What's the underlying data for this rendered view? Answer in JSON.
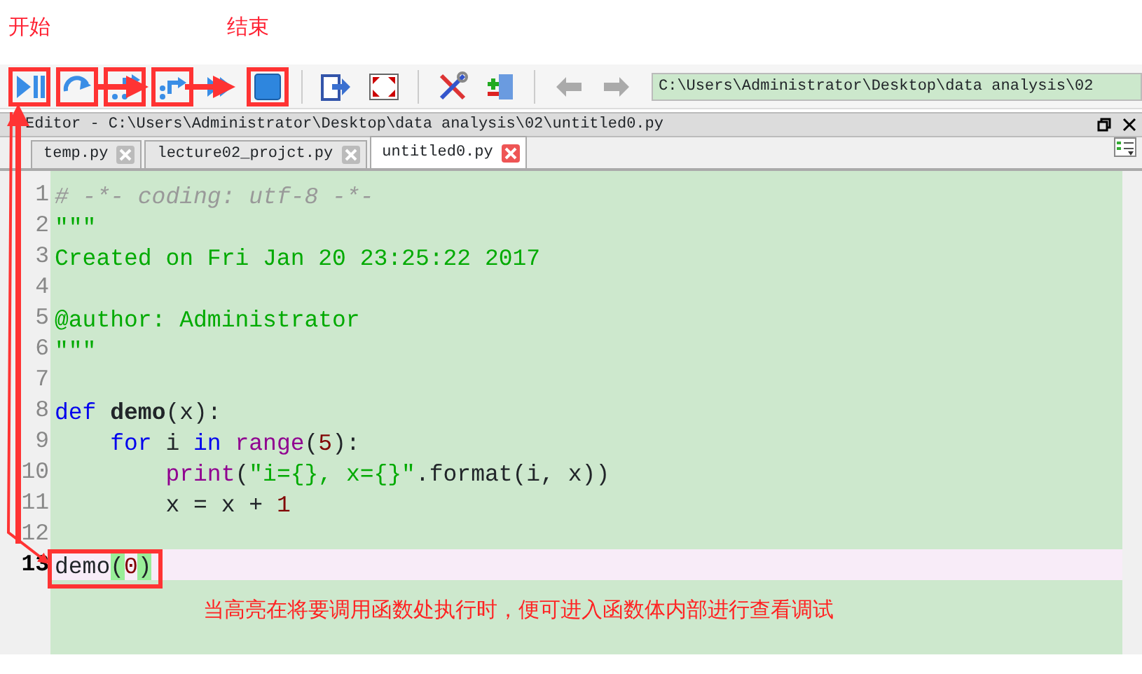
{
  "annotations": {
    "labels": [
      {
        "text": "开始"
      },
      {
        "text": "结束"
      }
    ],
    "caption": "当高亮在将要调用函数处执行时，便可进入函数体内部进行查看调试"
  },
  "toolbar": {
    "buttons": [
      {
        "kind": "run-pause",
        "highlighted": true
      },
      {
        "kind": "step",
        "highlighted": true
      },
      {
        "kind": "step-into",
        "highlighted": true
      },
      {
        "kind": "step-return",
        "highlighted": true
      },
      {
        "kind": "continue",
        "highlighted": false
      },
      {
        "kind": "stop",
        "highlighted": true
      },
      {
        "kind": "sep"
      },
      {
        "kind": "exit",
        "highlighted": false
      },
      {
        "kind": "maximize",
        "highlighted": false
      },
      {
        "kind": "sep"
      },
      {
        "kind": "tools",
        "highlighted": false
      },
      {
        "kind": "path-add",
        "highlighted": false
      },
      {
        "kind": "sep"
      },
      {
        "kind": "back",
        "highlighted": false
      },
      {
        "kind": "forward",
        "highlighted": false
      }
    ],
    "path": "C:\\Users\\Administrator\\Desktop\\data analysis\\02"
  },
  "editor": {
    "title": "Editor - C:\\Users\\Administrator\\Desktop\\data analysis\\02\\untitled0.py",
    "tabs": [
      {
        "label": "temp.py",
        "selected": false
      },
      {
        "label": "lecture02_projct.py",
        "selected": false
      },
      {
        "label": "untitled0.py",
        "selected": true
      }
    ],
    "lines": [
      {
        "number": "1",
        "current": false,
        "tokens": [
          {
            "text": "# -*- coding: utf-8 -*-",
            "kind": "comment"
          }
        ]
      },
      {
        "number": "2",
        "current": false,
        "tokens": [
          {
            "text": "\"\"\"",
            "kind": "string"
          }
        ]
      },
      {
        "number": "3",
        "current": false,
        "tokens": [
          {
            "text": "Created on Fri Jan 20 23:25:22 2017",
            "kind": "string"
          }
        ]
      },
      {
        "number": "4",
        "current": false
      },
      {
        "number": "5",
        "current": false,
        "tokens": [
          {
            "text": "@author: Administrator",
            "kind": "string"
          }
        ]
      },
      {
        "number": "6",
        "current": false,
        "tokens": [
          {
            "text": "\"\"\"",
            "kind": "string"
          }
        ]
      },
      {
        "number": "7",
        "current": false
      },
      {
        "number": "8",
        "current": false,
        "tokens": [
          {
            "text": "def",
            "kind": "keyword"
          },
          {
            "text": " demo",
            "kind": "defname"
          },
          {
            "text": "(x):",
            "kind": "plain"
          }
        ]
      },
      {
        "number": "9",
        "current": false,
        "tokens": [
          {
            "text": "    for",
            "kind": "keyword"
          },
          {
            "text": " i ",
            "kind": "plain"
          },
          {
            "text": "in",
            "kind": "keyword"
          },
          {
            "text": " range",
            "kind": "builtin"
          },
          {
            "text": "(",
            "kind": "plain"
          },
          {
            "text": "5",
            "kind": "number"
          },
          {
            "text": "):",
            "kind": "plain"
          }
        ]
      },
      {
        "number": "10",
        "current": false,
        "tokens": [
          {
            "text": "        print",
            "kind": "builtin"
          },
          {
            "text": "(",
            "kind": "plain"
          },
          {
            "text": "\"i={}, x={}\"",
            "kind": "string"
          },
          {
            "text": ".format(i, x))",
            "kind": "plain"
          }
        ]
      },
      {
        "number": "11",
        "current": false,
        "tokens": [
          {
            "text": "        x = x + ",
            "kind": "plain"
          },
          {
            "text": "1",
            "kind": "number"
          }
        ]
      },
      {
        "number": "12",
        "current": false
      },
      {
        "number": "13",
        "current": true,
        "tokens": [
          {
            "text": "demo",
            "kind": "plain"
          },
          {
            "text": "(",
            "kind": "match"
          },
          {
            "text": "0",
            "kind": "number"
          },
          {
            "text": ")",
            "kind": "match"
          }
        ]
      }
    ]
  }
}
